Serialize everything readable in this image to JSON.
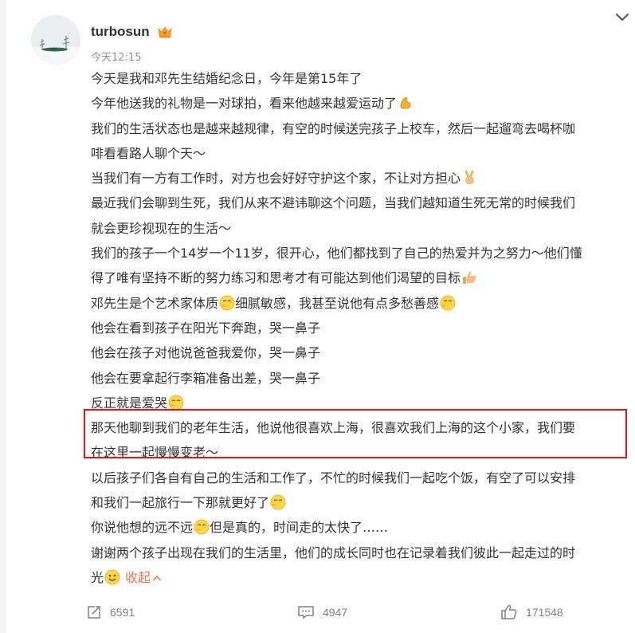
{
  "post": {
    "username": "turbosun",
    "time": "今天12:15",
    "lines": [
      "今天是我和邓先生结婚纪念日，今年是第15年了",
      "今年他送我的礼物是一对球拍，看来他越来越爱运动了",
      "我们的生活状态也是越来越规律，有空的时候送完孩子上校车，然后一起遛弯去喝杯咖",
      "啡看看路人聊个天～",
      "当我们有一方有工作时，对方也会好好守护这个家，不让对方担心",
      "最近我们会聊到生死，我们从来不避讳聊这个问题，当我们越知道生死无常的时候我们",
      "就会更珍视现在的生活～",
      "我们的孩子一个14岁一个11岁，很开心，他们都找到了自己的热爱并为之努力～他们懂",
      "得了唯有坚持不断的努力练习和思考才有可能达到他们渴望的目标",
      "邓先生是个艺术家体质",
      "细腻敏感，我甚至说他有点多愁善感",
      "他会在看到孩子在阳光下奔跑，哭一鼻子",
      "他会在孩子对他说爸爸我爱你，哭一鼻子",
      "他会在要拿起行李箱准备出差，哭一鼻子",
      "反正就是爱哭",
      "那天他聊到我们的老年生活，他说他很喜欢上海，很喜欢我们上海的这个小家，我们要",
      "在这里一起慢慢变老～",
      "以后孩子们各自有自己的生活和工作了，不忙的时候我们一起吃个饭，有空了可以安排",
      "和我们一起旅行一下那就更好了",
      "你说他想的远不远",
      "但是真的，时间走的太快了……",
      "谢谢两个孩子出现在我们的生活里，他们的成长同时也在记录着我们彼此一起走过的时",
      "光"
    ],
    "collapse_label": "收起"
  },
  "actions": {
    "repost_count": "6591",
    "comment_count": "4947",
    "like_count": "171548"
  },
  "icons": {
    "crown": "crown-icon",
    "collapse": "chevron-down-icon",
    "repost": "repost-icon",
    "comment": "comment-icon",
    "like": "thumbs-up-icon"
  },
  "colors": {
    "link": "#eb7350",
    "highlight_border": "#e3141b",
    "text": "#333333",
    "muted": "#939393"
  }
}
